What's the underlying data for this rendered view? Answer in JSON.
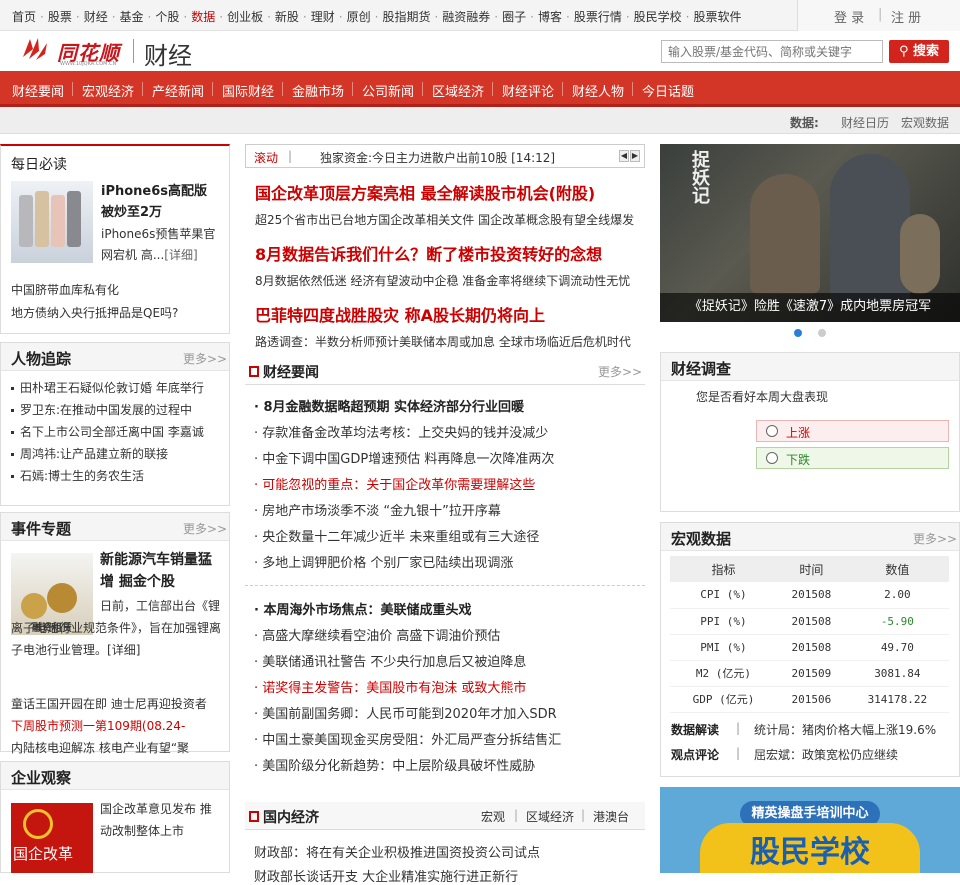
{
  "topnav": {
    "links": [
      "首页",
      "股票",
      "财经",
      "基金",
      "个股",
      "数据",
      "创业板",
      "新股",
      "理财",
      "原创",
      "股指期货",
      "融资融券",
      "圈子",
      "博客",
      "股票行情",
      "股民学校",
      "股票软件"
    ],
    "highlight_index": 5,
    "login": "登 录",
    "register": "注 册"
  },
  "logo": {
    "name": "同花顺",
    "url": "WWW.10JQKA.COM.CN",
    "section": "财经"
  },
  "search": {
    "placeholder": "输入股票/基金代码、简称或关键字",
    "button": "搜索"
  },
  "rednav": [
    "财经要闻",
    "宏观经济",
    "产经新闻",
    "国际财经",
    "金融市场",
    "公司新闻",
    "区域经济",
    "财经评论",
    "财经人物",
    "今日话题"
  ],
  "databar": {
    "label": "数据:",
    "links": [
      "财经日历",
      "宏观数据"
    ]
  },
  "daily": {
    "title": "每日必读",
    "feature_title": "iPhone6s高配版被炒至2万",
    "feature_desc": "iPhone6s预售苹果官网宕机 高...",
    "feature_link": "[详细]",
    "items": [
      "中国脐带血库私有化",
      "地方债纳入央行抵押品是QE吗?"
    ]
  },
  "people": {
    "title": "人物追踪",
    "more": "更多>>",
    "items": [
      "田朴珺王石疑似伦敦订婚 年底举行",
      "罗卫东:在推动中国发展的过程中",
      "名下上市公司全部迁离中国 李嘉诚",
      "周鸿祎:让产品建立新的联接",
      "石嫣:博士生的务农生活"
    ]
  },
  "events": {
    "title": "事件专题",
    "more": "更多>>",
    "img_caption": "融资租赁",
    "feature_title": "新能源汽车销量猛增 掘金个股",
    "feature_desc": "日前，工信部出台《锂离子电池行业规范条件》，旨在加强锂离子电池行业管理。",
    "feature_link": "[详细]",
    "items": [
      "童话王国开园在即 迪士尼再迎投资者",
      "下周股市预测一第109期(08.24-",
      "内陆核电迎解冻 核电产业有望“聚"
    ]
  },
  "enterprise": {
    "title": "企业观察",
    "img_caption": "国企改革",
    "feature_desc": "国企改革意见发布 推动改制整体上市"
  },
  "ticker": {
    "label": "滚动",
    "text": "独家资金:今日主力进散户出前10股 [14:12]"
  },
  "headlines": [
    {
      "title": "国企改革顶层方案亮相 最全解读股市机会(附股)",
      "sub": "超25个省市出已台地方国企改革相关文件 国企改革概念股有望全线爆发"
    },
    {
      "title": "8月数据告诉我们什么？断了楼市投资转好的念想",
      "sub": "8月数据依然低迷 经济有望波动中企稳 准备金率将继续下调流动性无忧"
    },
    {
      "title": "巴菲特四度战胜股灾 称A股长期仍将向上",
      "sub": "路透调查：半数分析师预计美联储本周或加息 全球市场临近后危机时代"
    }
  ],
  "cjyw": {
    "title": "财经要闻",
    "more": "更多>>",
    "group1": [
      {
        "text": "8月金融数据略超预期 实体经济部分行业回暖",
        "style": "b"
      },
      {
        "text": "存款准备金改革均法考核：上交央妈的钱并没减少",
        "style": ""
      },
      {
        "text": "中金下调中国GDP增速预估 料再降息一次降准两次",
        "style": ""
      },
      {
        "text": "可能忽视的重点：关于国企改革你需要理解这些",
        "style": "r"
      },
      {
        "text": "房地产市场淡季不淡 “金九银十”拉开序幕",
        "style": ""
      },
      {
        "text": "央企数量十二年减少近半 未来重组或有三大途径",
        "style": ""
      },
      {
        "text": "多地上调钾肥价格 个别厂家已陆续出现调涨",
        "style": ""
      }
    ],
    "group2": [
      {
        "text": "本周海外市场焦点：美联储成重头戏",
        "style": "b"
      },
      {
        "text": "高盛大摩继续看空油价 高盛下调油价预估",
        "style": ""
      },
      {
        "text": "美联储通讯社警告 不少央行加息后又被迫降息",
        "style": ""
      },
      {
        "text": "诺奖得主发警告：美国股市有泡沫 或致大熊市",
        "style": "r"
      },
      {
        "text": "美国前副国务卿：人民币可能到2020年才加入SDR",
        "style": ""
      },
      {
        "text": "中国土豪美国现金买房受阻：外汇局严查分拆结售汇",
        "style": ""
      },
      {
        "text": "美国阶级分化新趋势：中上层阶级具破坏性威胁",
        "style": ""
      }
    ]
  },
  "gnjj": {
    "title": "国内经济",
    "tabs": [
      "宏观",
      "区域经济",
      "港澳台"
    ],
    "items": [
      "财政部：将在有关企业积极推进国资投资公司试点",
      "财政部长谈话开支 大企业精准实施行进正新行"
    ]
  },
  "banner": {
    "caption": "《捉妖记》险胜《速激7》成内地票房冠军",
    "poster_text": "捉妖记"
  },
  "survey": {
    "title": "财经调查",
    "question": "您是否看好本周大盘表现",
    "options": [
      "上涨",
      "下跌"
    ]
  },
  "macro": {
    "title": "宏观数据",
    "more": "更多>>",
    "headers": [
      "指标",
      "时间",
      "数值"
    ],
    "rows": [
      {
        "name": "CPI (%)",
        "time": "201508",
        "value": "2.00",
        "color": "#333"
      },
      {
        "name": "PPI (%)",
        "time": "201508",
        "value": "-5.90",
        "color": "#2a8a2a"
      },
      {
        "name": "PMI (%)",
        "time": "201508",
        "value": "49.70",
        "color": "#333"
      },
      {
        "name": "M2 (亿元)",
        "time": "201509",
        "value": "3081.84",
        "color": "#333"
      },
      {
        "name": "GDP (亿元)",
        "time": "201506",
        "value": "314178.22",
        "color": "#333"
      }
    ],
    "reading_label": "数据解读",
    "reading_text": "统计局：猪肉价格大幅上涨19.6%",
    "view_label": "观点评论",
    "view_text": "屈宏斌：政策宽松仍应继续"
  },
  "school_banner": {
    "top": "精英操盘手培训中心",
    "main": "股民学校"
  },
  "colors": {
    "brand_red": "#d33526",
    "headline_red": "#c00000",
    "down_green": "#2a8a2a"
  }
}
